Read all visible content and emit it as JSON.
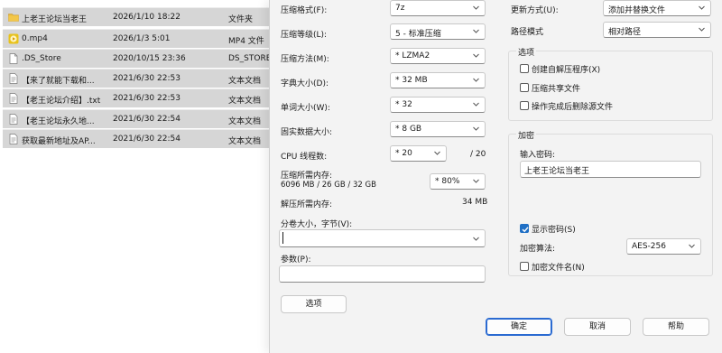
{
  "explorer": {
    "files": [
      {
        "icon": "folder-icon",
        "name": "上老王论坛当老王",
        "date": "2026/1/10 18:22",
        "type": "文件夹"
      },
      {
        "icon": "video-file-icon",
        "name": "0.mp4",
        "date": "2026/1/3 5:01",
        "type": "MP4 文件"
      },
      {
        "icon": "file-icon",
        "name": ".DS_Store",
        "date": "2020/10/15 23:36",
        "type": "DS_STORE"
      },
      {
        "icon": "text-file-icon",
        "name": "【来了就能下载和...",
        "date": "2021/6/30 22:53",
        "type": "文本文档"
      },
      {
        "icon": "text-file-icon",
        "name": "【老王论坛介绍】.txt",
        "date": "2021/6/30 22:53",
        "type": "文本文档"
      },
      {
        "icon": "text-file-icon",
        "name": "【老王论坛永久地...",
        "date": "2021/6/30 22:54",
        "type": "文本文档"
      },
      {
        "icon": "text-file-icon",
        "name": "获取最新地址及AP...",
        "date": "2021/6/30 22:54",
        "type": "文本文档"
      }
    ]
  },
  "dialog": {
    "format": {
      "label": "压缩格式(F):",
      "value": "7z"
    },
    "level": {
      "label": "压缩等级(L):",
      "value": "5 - 标准压缩"
    },
    "method": {
      "label": "压缩方法(M):",
      "value": "* LZMA2"
    },
    "dict": {
      "label": "字典大小(D):",
      "value": "* 32 MB"
    },
    "word": {
      "label": "单词大小(W):",
      "value": "* 32"
    },
    "solid": {
      "label": "固实数据大小:",
      "value": "* 8 GB"
    },
    "threads": {
      "label": "CPU 线程数:",
      "value": "* 20",
      "max": "/ 20"
    },
    "mem_compress": {
      "label": "压缩所需内存:",
      "detail": "6096 MB / 26 GB / 32 GB",
      "percent": "* 80%"
    },
    "mem_decompress": {
      "label": "解压所需内存:",
      "value": "34 MB"
    },
    "split": {
      "label": "分卷大小，字节(V):",
      "value": ""
    },
    "params": {
      "label": "参数(P):",
      "value": ""
    },
    "options_button": "选项",
    "update": {
      "label": "更新方式(U):",
      "value": "添加并替换文件"
    },
    "path_mode": {
      "label": "路径模式",
      "value": "相对路径"
    },
    "options_group": {
      "title": "选项",
      "sfx": {
        "label": "创建自解压程序(X)",
        "checked": false
      },
      "shared": {
        "label": "压缩共享文件",
        "checked": false
      },
      "delete_after": {
        "label": "操作完成后删除源文件",
        "checked": false
      }
    },
    "encryption": {
      "title": "加密",
      "password_label": "输入密码:",
      "password_value": "上老王论坛当老王",
      "show_password": {
        "label": "显示密码(S)",
        "checked": true
      },
      "method_label": "加密算法:",
      "method_value": "AES-256",
      "encrypt_names": {
        "label": "加密文件名(N)",
        "checked": false
      }
    },
    "buttons": {
      "ok": "确定",
      "cancel": "取消",
      "help": "帮助"
    }
  },
  "colors": {
    "accent": "#1f6fc5",
    "folder": "#e8b93a",
    "video": "#e8c21a",
    "selection": "#d6d6d6"
  }
}
